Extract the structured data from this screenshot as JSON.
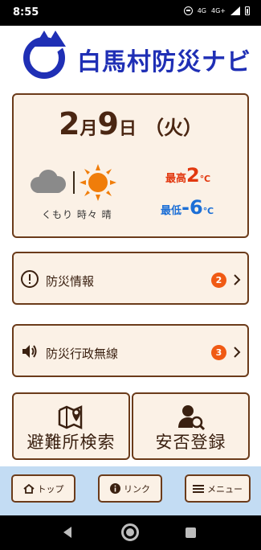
{
  "status_bar": {
    "time": "8:55",
    "network_1": "4G",
    "network_2": "4G+"
  },
  "header": {
    "title": "白馬村防災ナビ",
    "brand_color": "#1f2fb5"
  },
  "weather": {
    "month": "2",
    "month_unit": "月",
    "day": "9",
    "day_unit": "日",
    "weekday": "（火）",
    "description": "くもり 時々 晴",
    "icons": [
      "cloud-icon",
      "sun-icon"
    ],
    "high_caption": "最高",
    "high_value": "2",
    "low_caption": "最低",
    "low_value": "-6",
    "unit": "℃",
    "high_color": "#e2380f",
    "low_color": "#1c6fd6"
  },
  "rows": [
    {
      "label": "防災情報",
      "badge": "2",
      "icon": "exclamation-circle-icon"
    },
    {
      "label": "防災行政無線",
      "badge": "3",
      "icon": "speaker-icon"
    }
  ],
  "big_buttons": [
    {
      "label": "避難所検索",
      "icon": "map-pin-icon"
    },
    {
      "label": "安否登録",
      "icon": "person-search-icon"
    }
  ],
  "bottom_nav": {
    "top_label": "トップ",
    "link_label": "リンク",
    "menu_label": "メニュー"
  },
  "colors": {
    "card_bg": "#fbf1e6",
    "card_border": "#6b3b1a",
    "badge": "#f05a14",
    "nav_bg": "#c3dcf3"
  }
}
